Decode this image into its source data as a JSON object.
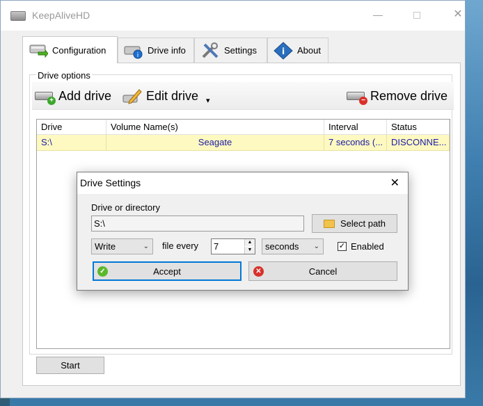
{
  "window": {
    "title": "KeepAliveHD",
    "minimize": "—",
    "close": "✕"
  },
  "tabs": [
    {
      "label": "Configuration",
      "icon": "drive-arrow-icon",
      "active": true
    },
    {
      "label": "Drive info",
      "icon": "drive-info-icon",
      "active": false
    },
    {
      "label": "Settings",
      "icon": "tools-icon",
      "active": false
    },
    {
      "label": "About",
      "icon": "info-diamond-icon",
      "active": false
    }
  ],
  "drive_options": {
    "group_label": "Drive options",
    "toolbar": {
      "add_label": "Add drive",
      "edit_label": "Edit drive",
      "caret": "▾",
      "remove_label": "Remove drive"
    },
    "table": {
      "columns": [
        "Drive",
        "Volume Name(s)",
        "Interval",
        "Status"
      ],
      "rows": [
        {
          "drive": "S:\\",
          "volume": "Seagate",
          "interval": "7 seconds (...",
          "status": "DISCONNE..."
        }
      ]
    }
  },
  "start_label": "Start",
  "dialog": {
    "title": "Drive Settings",
    "close": "✕",
    "path_label": "Drive or directory",
    "path_value": "S:\\",
    "select_path_label": "Select path",
    "mode_value": "Write",
    "file_every_label": "file every",
    "interval_value": "7",
    "unit_value": "seconds",
    "enabled_label": "Enabled",
    "enabled_checked": "✓",
    "accept_label": "Accept",
    "cancel_label": "Cancel"
  },
  "colors": {
    "row_highlight": "#fdf9c0",
    "row_text": "#1a1aa8",
    "accent": "#0078d7"
  }
}
